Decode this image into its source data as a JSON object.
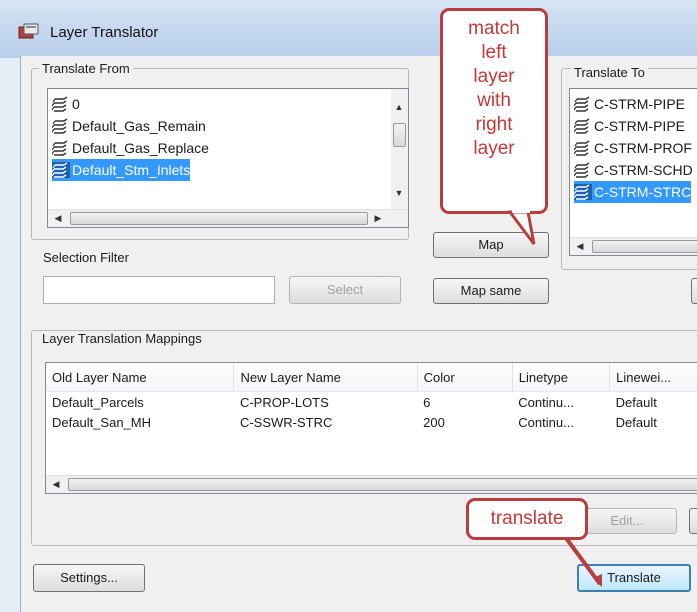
{
  "window": {
    "title": "Layer Translator"
  },
  "translate_from": {
    "label": "Translate From",
    "items": [
      {
        "name": "0",
        "selected": false
      },
      {
        "name": "Default_Gas_Remain",
        "selected": false
      },
      {
        "name": "Default_Gas_Replace",
        "selected": false
      },
      {
        "name": "Default_Stm_Inlets",
        "selected": true
      }
    ]
  },
  "translate_to": {
    "label": "Translate To",
    "items": [
      {
        "name": "C-STRM-PIPE",
        "selected": false
      },
      {
        "name": "C-STRM-PIPE",
        "selected": false
      },
      {
        "name": "C-STRM-PROF",
        "selected": false
      },
      {
        "name": "C-STRM-SCHD",
        "selected": false
      },
      {
        "name": "C-STRM-STRC",
        "selected": true
      }
    ]
  },
  "selection_filter": {
    "label": "Selection Filter",
    "value": "",
    "select_label": "Select"
  },
  "buttons": {
    "map": "Map",
    "map_same": "Map same",
    "edit": "Edit...",
    "settings": "Settings...",
    "translate": "Translate"
  },
  "mappings": {
    "label": "Layer Translation Mappings",
    "columns": [
      "Old Layer Name",
      "New Layer Name",
      "Color",
      "Linetype",
      "Linewei..."
    ],
    "rows": [
      [
        "Default_Parcels",
        "C-PROP-LOTS",
        "6",
        "Continu...",
        "Default"
      ],
      [
        "Default_San_MH",
        "C-SSWR-STRC",
        "200",
        "Continu...",
        "Default"
      ]
    ]
  },
  "annotations": {
    "map_callout_lines": [
      "match",
      "left",
      "layer",
      "with",
      "right",
      "layer"
    ],
    "translate_callout": "translate"
  },
  "colors": {
    "selection": "#3399ff",
    "callout_border": "#b63e3e",
    "callout_text": "#c03a3a",
    "title_gradient": "#c3d6ee"
  }
}
